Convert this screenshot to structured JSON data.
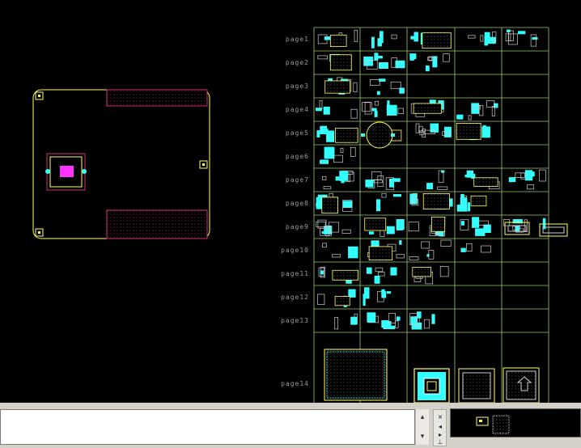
{
  "window": {
    "title": ""
  },
  "pages": [
    "page1",
    "page2",
    "page3",
    "page4",
    "page5",
    "page6",
    "page7",
    "page8",
    "page9",
    "page10",
    "page11",
    "page12",
    "page13",
    "page14"
  ],
  "command": {
    "value": ""
  },
  "scroll": {
    "up": "▴",
    "down": "▾"
  },
  "view_controls": {
    "close": "×",
    "left": "◂",
    "right": "▸",
    "zoom": "⊥"
  },
  "icons": {
    "scroll_up": "chevron-up-icon",
    "scroll_down": "chevron-down-icon",
    "close": "close-icon"
  },
  "colors": {
    "canvas": "#000000",
    "board_outline": "#ffff66",
    "keepout": "#cc3366",
    "grid": "#9ccc66",
    "component": "#33ffff",
    "text": "#9a9a9a",
    "highlight": "#ff33ff"
  }
}
